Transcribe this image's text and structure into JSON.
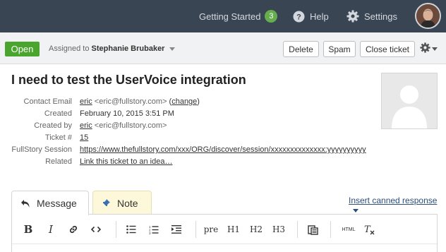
{
  "nav": {
    "getting_started": "Getting Started",
    "getting_started_count": "3",
    "help": "Help",
    "settings": "Settings"
  },
  "actions": {
    "status": "Open",
    "assigned_prefix": "Assigned to",
    "assignee": "Stephanie Brubaker",
    "delete": "Delete",
    "spam": "Spam",
    "close": "Close ticket"
  },
  "ticket": {
    "title": "I need to test the UserVoice integration",
    "fields": {
      "contact_email_label": "Contact Email",
      "contact_name": "eric",
      "contact_email": "<eric@fullstory.com>",
      "change_open": "(",
      "change_link": "change",
      "change_close": ")",
      "created_label": "Created",
      "created_value": "February 10, 2015 3:51 PM",
      "created_by_label": "Created by",
      "created_by_name": "eric",
      "created_by_email": "<eric@fullstory.com>",
      "ticket_num_label": "Ticket #",
      "ticket_num": "15",
      "fullstory_label": "FullStory Session",
      "fullstory_url": "https://www.thefullstory.com/xxx/ORG/discover/session/xxxxxxxxxxxxxx:yyyyyyyyyy",
      "related_label": "Related",
      "related_link": "Link this ticket to an idea…"
    }
  },
  "composer": {
    "tab_message": "Message",
    "tab_note": "Note",
    "canned": "Insert canned response",
    "toolbar": {
      "pre": "pre",
      "h1": "H1",
      "h2": "H2",
      "h3": "H3",
      "html": "HTML"
    }
  },
  "colors": {
    "topbar": "#3a4554",
    "open_green": "#4aa52e",
    "badge_green": "#65ad4f",
    "note_tab": "#fdf8d9",
    "link_blue": "#2a4d7a"
  }
}
